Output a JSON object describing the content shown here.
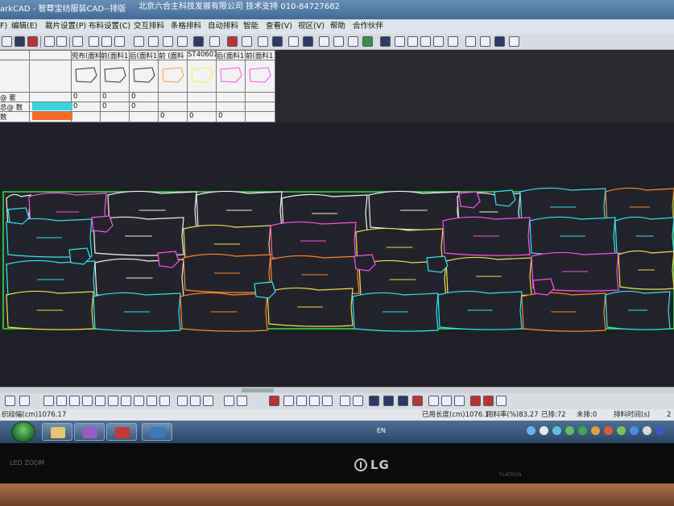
{
  "window": {
    "app_title": "arkCAD - 智尊宝纺服装CAD--排版",
    "company": "北京六合主科技发展有限公司 技术支持  010-84727682"
  },
  "menu": {
    "items": [
      "F)",
      "编辑(E)",
      "裁片设置(P)",
      "布料设置(C)",
      "交互排料",
      "条格排料",
      "自动排料",
      "智能",
      "查看(V)",
      "视区(V)",
      "帮助",
      "合作伙伴"
    ]
  },
  "pieces_panel": {
    "columns": [
      "兜布(面料",
      "前(面料1",
      "后(面料1",
      "前 (面料",
      "ST40601",
      "后(面料1",
      "前(面料1"
    ],
    "rows": [
      {
        "label": "@ 套",
        "values": [
          "0",
          "0",
          "0",
          "",
          "",
          "",
          ""
        ]
      },
      {
        "label": "总@ 数",
        "values": [
          "0",
          "0",
          "0",
          "",
          "",
          "",
          ""
        ]
      },
      {
        "label": "数",
        "values": [
          "",
          "",
          "",
          "0",
          "0",
          "0",
          ""
        ]
      }
    ],
    "swatches": [
      "#33d6e0",
      "#ff6a22"
    ],
    "piece_colors": [
      "#ffffff",
      "#ffffff",
      "#ffffff",
      "#ff9a3a",
      "#f2f24a",
      "#ff4ff0",
      "#ff4ff0"
    ]
  },
  "layout": {
    "border_color": "#36e83a",
    "colors": {
      "white": "#f2f2f2",
      "cyan": "#2fe7f4",
      "orange": "#ff8a2a",
      "yellow": "#f5e04a",
      "magenta": "#ff52ef",
      "label": "#ff8a2a"
    }
  },
  "status": {
    "left": "织段幅(cm)1076.17",
    "used_length": "已用长度(cm)1076.1",
    "utilization": "用料率(%)83.27",
    "placed": "已排:72",
    "unplaced": "未排:0",
    "time": "排料时间(s)",
    "last": "2"
  },
  "taskbar": {
    "tray_text": "EN"
  },
  "monitor": {
    "brand": "LG",
    "model": "LED ZOOM",
    "small_print": "FLATRON"
  }
}
